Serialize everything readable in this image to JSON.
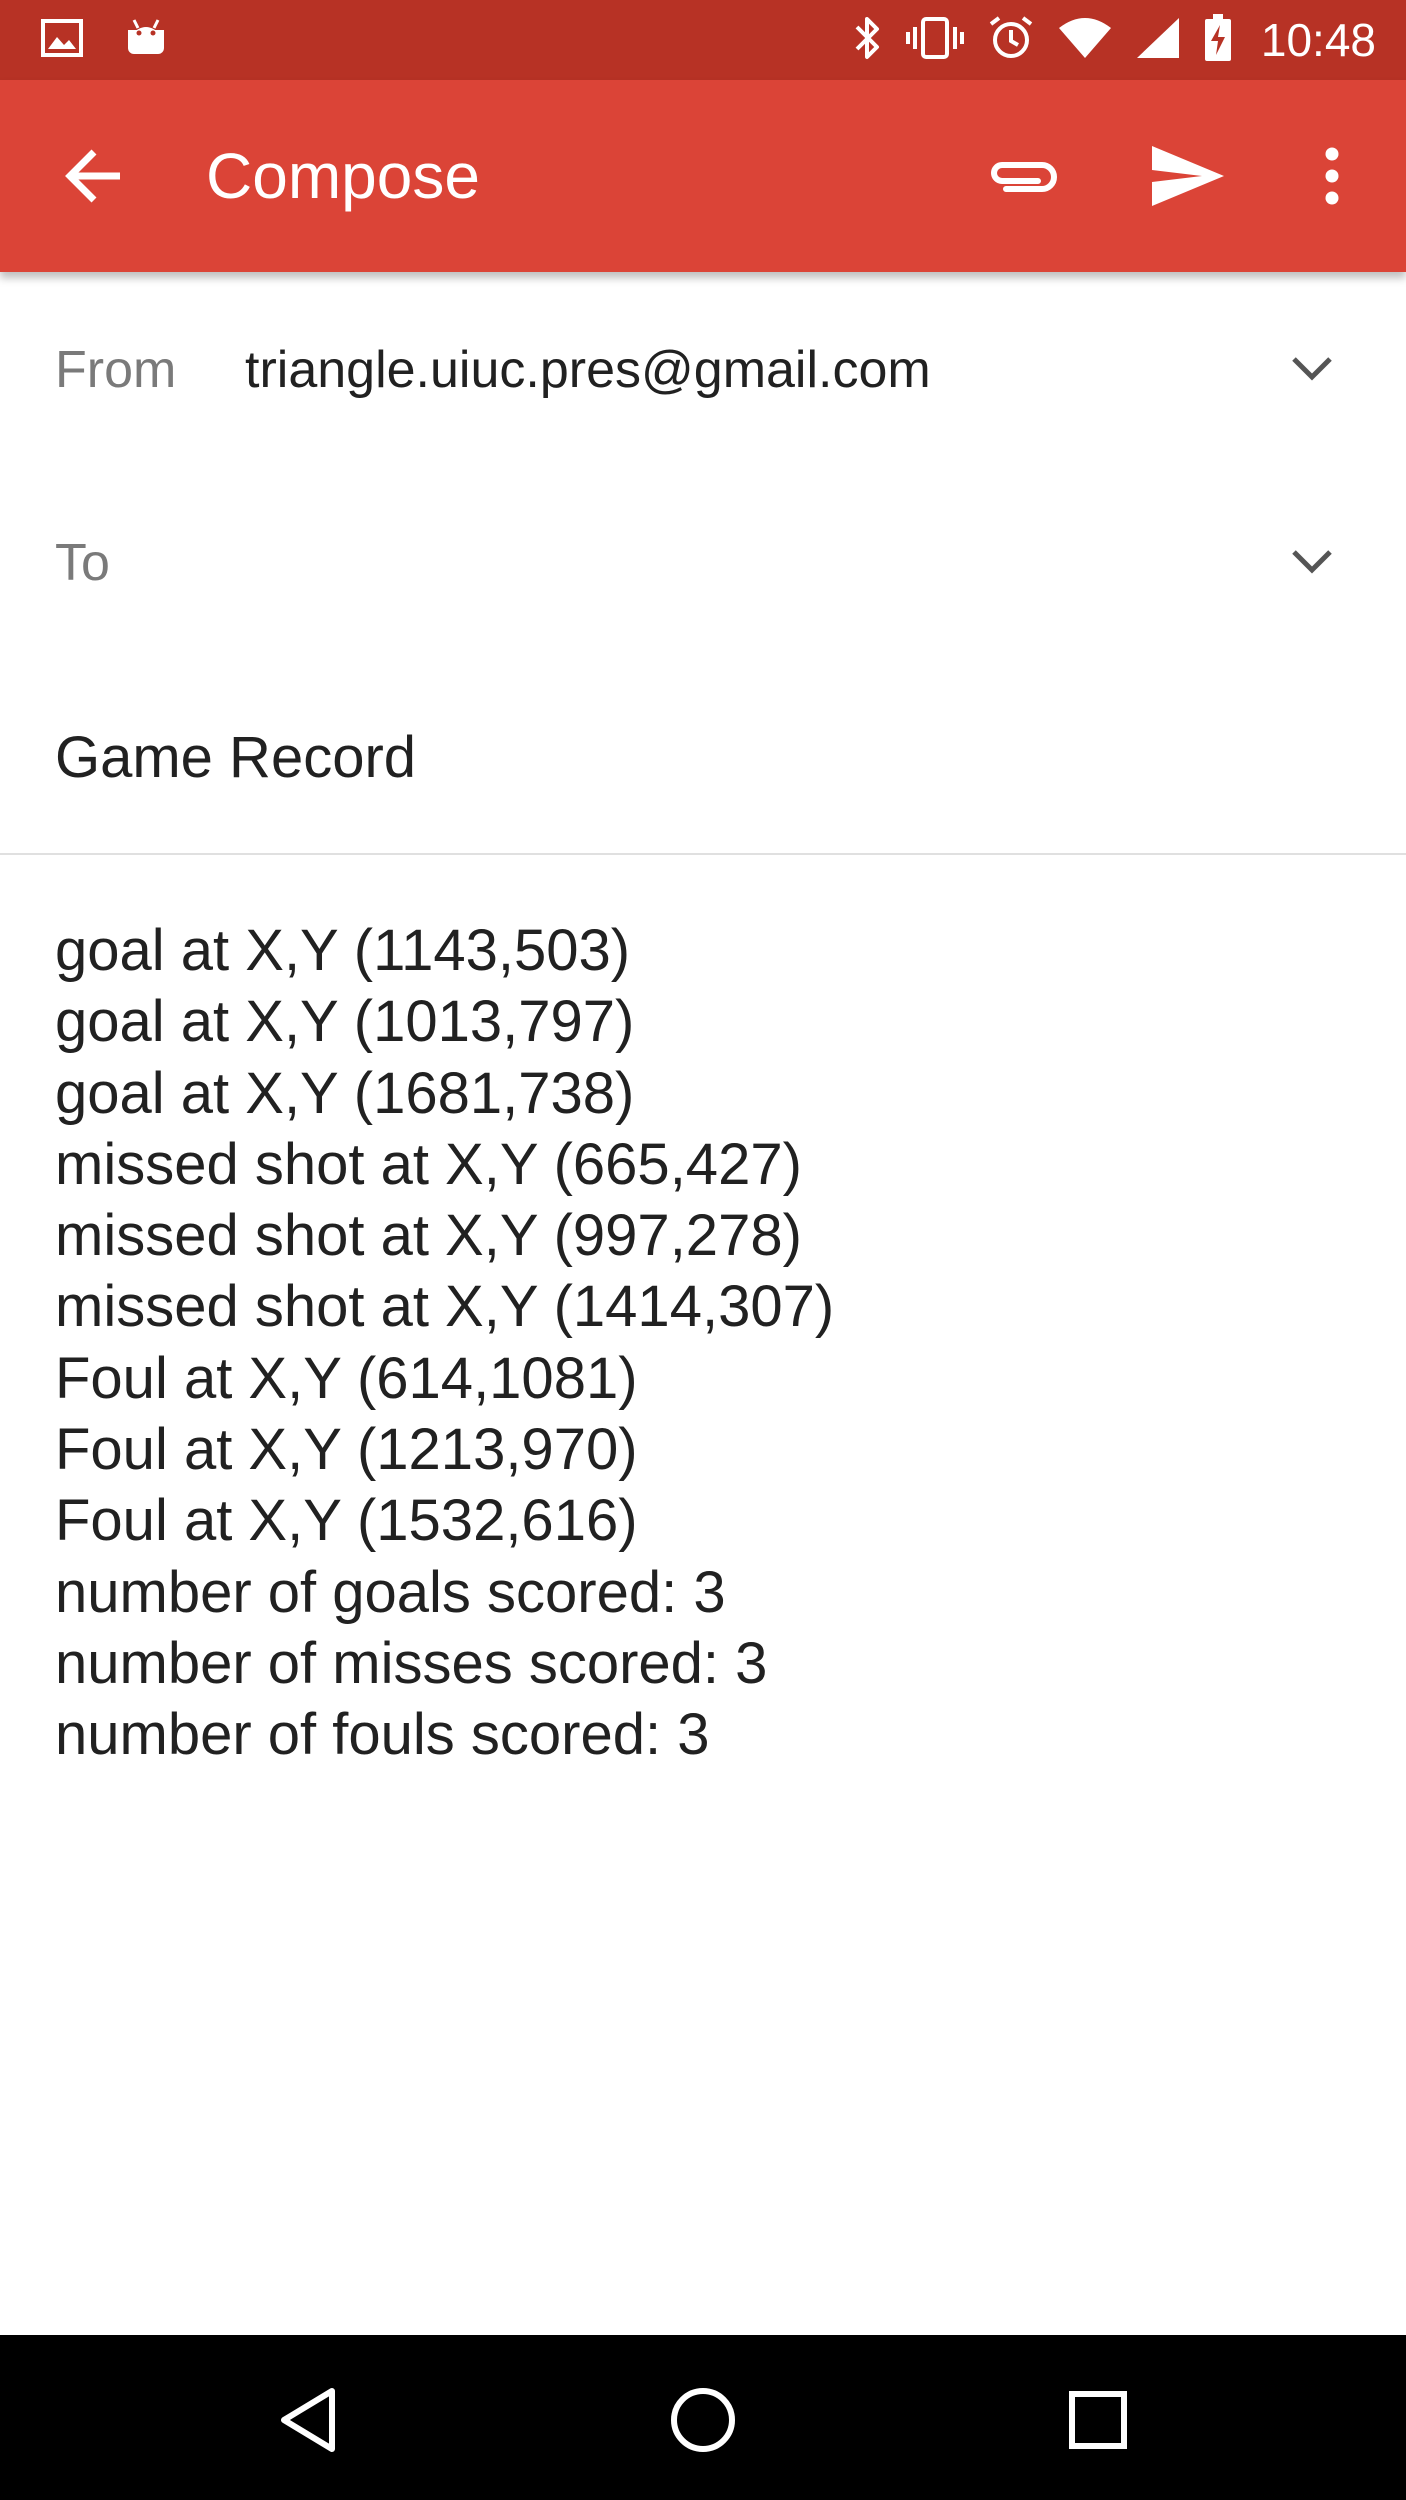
{
  "status_bar": {
    "time": "10:48",
    "icons": [
      "image-notification-icon",
      "android-notification-icon",
      "bluetooth-icon",
      "vibrate-icon",
      "alarm-icon",
      "wifi-icon",
      "cell-signal-icon",
      "battery-charging-icon"
    ]
  },
  "app_bar": {
    "title": "Compose",
    "actions": [
      "attach-icon",
      "send-icon",
      "more-vert-icon"
    ]
  },
  "from": {
    "label": "From",
    "value": "triangle.uiuc.pres@gmail.com"
  },
  "to": {
    "label": "To",
    "value": ""
  },
  "subject": {
    "value": "Game Record"
  },
  "body": {
    "lines": [
      "goal at X,Y (1143,503)",
      "goal at X,Y (1013,797)",
      "goal at X,Y (1681,738)",
      "missed shot at X,Y (665,427)",
      "missed shot at X,Y (997,278)",
      "missed shot at X,Y (1414,307)",
      "Foul at X,Y (614,1081)",
      "Foul at X,Y (1213,970)",
      "Foul at X,Y (1532,616)",
      "number of goals scored: 3",
      "number of misses scored: 3",
      "number of fouls scored: 3"
    ]
  },
  "nav_bar": {
    "buttons": [
      "back-nav-icon",
      "home-nav-icon",
      "recents-nav-icon"
    ]
  },
  "colors": {
    "status_bar": "#b73225",
    "app_bar": "#db4437",
    "nav_bar": "#000000"
  }
}
